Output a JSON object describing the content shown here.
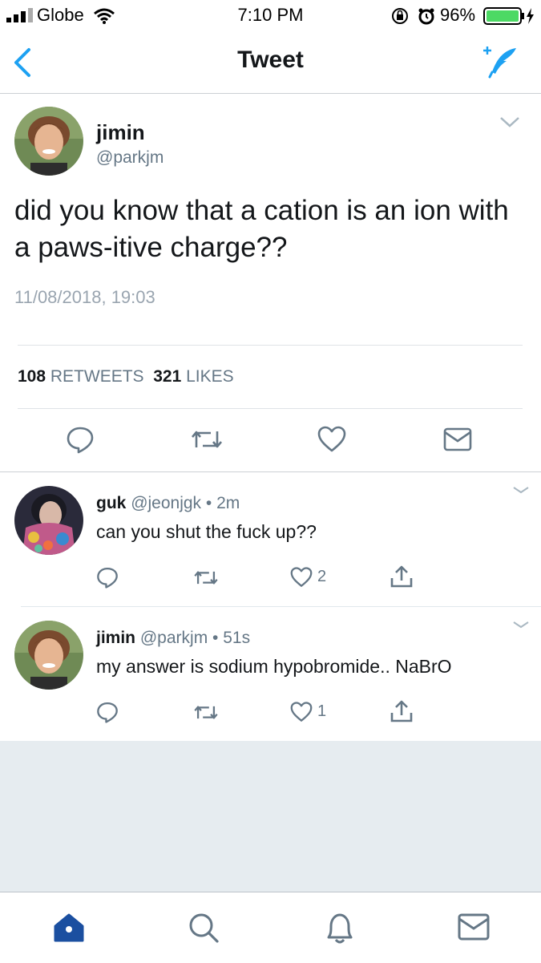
{
  "status_bar": {
    "carrier": "Globe",
    "time": "7:10 PM",
    "battery": "96%"
  },
  "nav": {
    "title": "Tweet"
  },
  "main_tweet": {
    "name": "jimin",
    "handle": "@parkjm",
    "text": "did you know that a cation is an ion with a paws-itive charge??",
    "date": "11/08/2018, 19:03",
    "retweets_count": "108",
    "retweets_label": "RETWEETS",
    "likes_count": "321",
    "likes_label": "LIKES"
  },
  "replies": [
    {
      "name": "guk",
      "handle": "@jeonjgk",
      "time": "• 2m",
      "text": "can you shut the fuck up??",
      "likes": "2"
    },
    {
      "name": "jimin",
      "handle": "@parkjm",
      "time": "• 51s",
      "text": "my answer is sodium hypobromide.. NaBrO",
      "likes": "1"
    }
  ],
  "colors": {
    "accent": "#1da1f2",
    "text": "#14171a",
    "secondary": "#657786",
    "background_gray": "#e6ecf0",
    "home_active": "#1b4fa0"
  },
  "icons": [
    "back-chevron-icon",
    "compose-icon",
    "reply-icon",
    "retweet-icon",
    "like-icon",
    "message-icon",
    "share-icon",
    "home-icon",
    "search-icon",
    "notifications-icon"
  ]
}
